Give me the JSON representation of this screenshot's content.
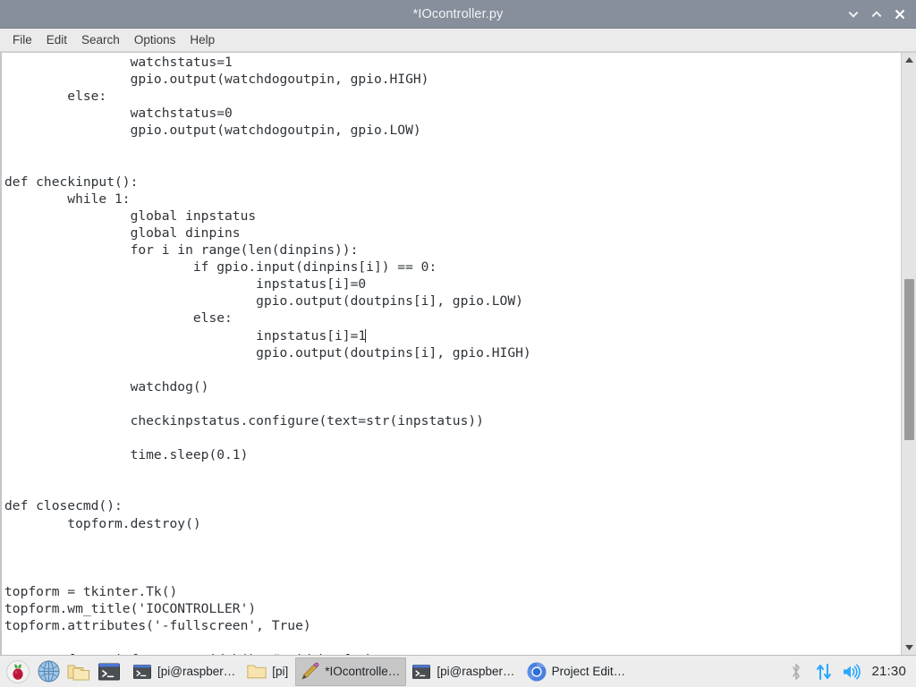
{
  "window": {
    "title": "*IOcontroller.py",
    "buttons": [
      {
        "name": "minimize",
        "glyph": "chevron-down"
      },
      {
        "name": "maximize",
        "glyph": "chevron-up"
      },
      {
        "name": "close",
        "glyph": "x"
      }
    ]
  },
  "menubar": {
    "items": [
      {
        "label": "File"
      },
      {
        "label": "Edit"
      },
      {
        "label": "Search"
      },
      {
        "label": "Options"
      },
      {
        "label": "Help"
      }
    ]
  },
  "editor": {
    "code_before_caret": "                watchstatus=1\n                gpio.output(watchdogoutpin, gpio.HIGH)\n        else:\n                watchstatus=0\n                gpio.output(watchdogoutpin, gpio.LOW)\n\n\ndef checkinput():\n        while 1:\n                global inpstatus\n                global dinpins\n                for i in range(len(dinpins)):\n                        if gpio.input(dinpins[i]) == 0:\n                                inpstatus[i]=0\n                                gpio.output(doutpins[i], gpio.LOW)\n                        else:\n                                inpstatus[i]=1",
    "code_after_caret": "\n                                gpio.output(doutpins[i], gpio.HIGH)\n\n                watchdog()\n\n                checkinpstatus.configure(text=str(inpstatus))\n\n                time.sleep(0.1)\n\n\ndef closecmd():\n        topform.destroy()\n\n\n\ntopform = tkinter.Tk()\ntopform.wm_title('IOCONTROLLER')\ntopform.attributes('-fullscreen', True)\n\nws = topform.winfo_screenwidth()  # width of the screen",
    "scrollbar": {
      "thumb_top_pct": 37,
      "thumb_height_pct": 28
    }
  },
  "taskbar": {
    "launchers": [
      {
        "name": "raspberry-menu-icon",
        "title": "Menu"
      },
      {
        "name": "globe-icon",
        "title": "Web Browser"
      },
      {
        "name": "folder-icon",
        "title": "File Manager"
      },
      {
        "name": "terminal-icon",
        "title": "Terminal"
      }
    ],
    "windows": [
      {
        "label": "[pi@raspber…",
        "icon": "terminal-icon",
        "active": false
      },
      {
        "label": "[pi]",
        "icon": "folder-icon",
        "active": false
      },
      {
        "label": "*IOcontrolle…",
        "icon": "pencil-icon",
        "active": true
      },
      {
        "label": "[pi@raspber…",
        "icon": "terminal-icon",
        "active": false
      },
      {
        "label": "Project Edit…",
        "icon": "chromium-icon",
        "active": false
      }
    ],
    "tray": [
      {
        "name": "bluetooth-icon",
        "color": "#b0b0b0"
      },
      {
        "name": "network-icon",
        "color": "#29a8ff"
      },
      {
        "name": "volume-icon",
        "color": "#29a8ff"
      }
    ],
    "clock": "21:30"
  },
  "colors": {
    "titlebar": "#868f9b",
    "menubar": "#ebebeb",
    "taskbar": "#ededed",
    "code_text": "#2e3338",
    "accent_blue": "#29a8ff"
  }
}
